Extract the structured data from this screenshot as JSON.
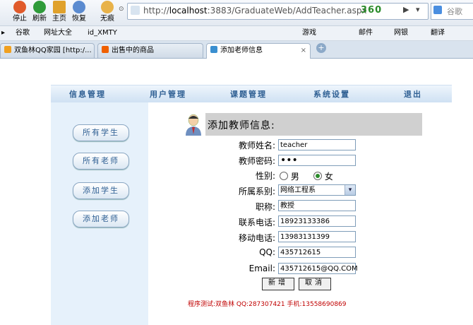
{
  "browser": {
    "nav_buttons": [
      {
        "label": "停止",
        "icon": "stop-icon",
        "color": "#e05a2b"
      },
      {
        "label": "刷新",
        "icon": "refresh-icon",
        "color": "#2f9b3a"
      },
      {
        "label": "主页",
        "icon": "home-icon",
        "color": "#e0a12b"
      },
      {
        "label": "恢复",
        "icon": "restore-icon",
        "color": "#5b8bd0"
      },
      {
        "label": "无痕",
        "icon": "incognito-icon",
        "color": "#e8b24a"
      }
    ],
    "url_prefix": "http://",
    "url_host": "localhost",
    "url_rest": ":3883/GraduateWeb/AddTeacher.aspx",
    "brand": "360",
    "search_engine": "谷歌",
    "bookmarks": [
      "谷歌",
      "网址大全",
      "id_XMTY"
    ],
    "right_bookmarks": [
      "游戏",
      "邮件",
      "网银",
      "翻译"
    ],
    "tabs": [
      {
        "label": "双鱼林QQ家园 [http:/...",
        "color": "#f0a020"
      },
      {
        "label": "出售中的商品",
        "color": "#f06000"
      },
      {
        "label": "添加老师信息",
        "color": "#3a8fd0"
      }
    ]
  },
  "topnav": [
    "信息管理",
    "用户管理",
    "课题管理",
    "系统设置",
    "退出"
  ],
  "sidebar": [
    "所有学生",
    "所有老师",
    "添加学生",
    "添加老师"
  ],
  "form": {
    "title": "添加教师信息:",
    "name_label": "教师姓名:",
    "name_value": "teacher",
    "password_label": "教师密码:",
    "password_value": "•••",
    "gender_label": "性别:",
    "gender_male": "男",
    "gender_female": "女",
    "gender_selected": "女",
    "dept_label": "所属系别:",
    "dept_value": "网络工程系",
    "title_label": "职称:",
    "title_value": "教授",
    "phone_label": "联系电话:",
    "phone_value": "18923133386",
    "mobile_label": "移动电话:",
    "mobile_value": "13983131399",
    "qq_label": "QQ:",
    "qq_value": "435712615",
    "email_label": "Email:",
    "email_value": "435712615@QQ.COM",
    "add_button": "新增",
    "cancel_button": "取消"
  },
  "footer": "程序测试:双鱼林 QQ:287307421 手机:13558690869",
  "colors": {
    "nav_text": "#2e5f93",
    "footer": "#c00000",
    "left_panel": "#e6f1fb"
  }
}
